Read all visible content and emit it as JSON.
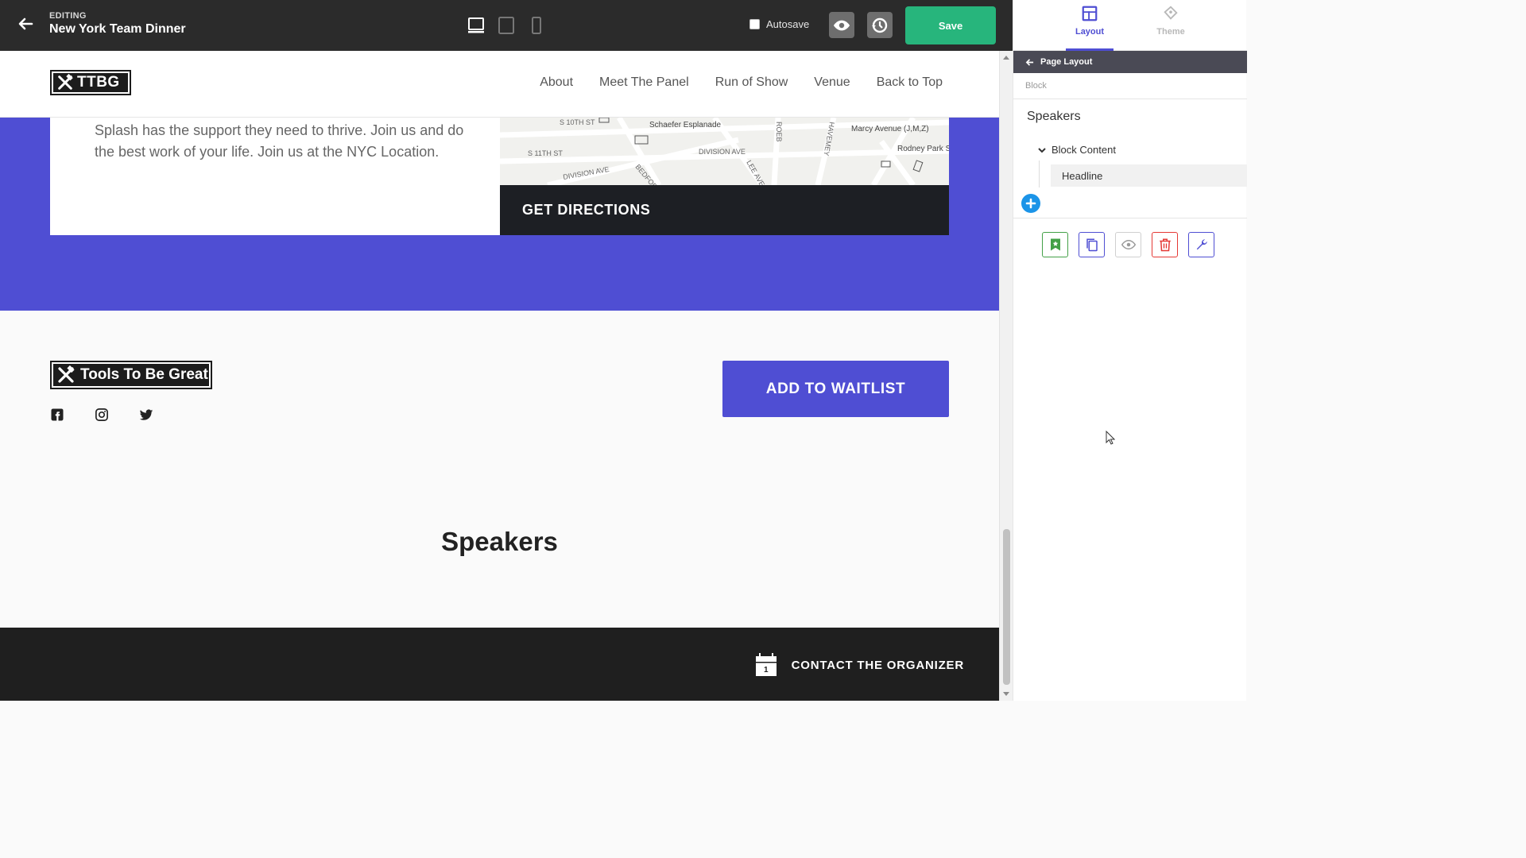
{
  "topbar": {
    "editing_label": "EDITING",
    "page_title": "New York Team Dinner",
    "autosave_label": "Autosave",
    "autosave_checked": false,
    "save_label": "Save",
    "active_device": "desktop"
  },
  "site_header": {
    "logo_text": "TTBG",
    "nav": [
      "About",
      "Meet The Panel",
      "Run of Show",
      "Venue",
      "Back to Top"
    ]
  },
  "venue": {
    "text": "Splash has the support they need to thrive. Join us and do the best work of your life. Join us at the NYC Location.",
    "map_labels": [
      "S 10TH ST",
      "Schaefer Esplanade",
      "Marcy Avenue (J,M,Z)",
      "S 11TH ST",
      "DIVISION AVE",
      "Rodney Park South",
      "DIVISION AVE",
      "BEDFORD",
      "LEE AVE",
      "ROEB",
      "HAVEMEY"
    ],
    "directions_label": "GET DIRECTIONS"
  },
  "footer": {
    "logo_text": "Tools To Be Great",
    "socials": [
      "facebook-icon",
      "instagram-icon",
      "twitter-icon"
    ],
    "waitlist_label": "ADD TO WAITLIST",
    "speakers_heading": "Speakers",
    "contact_label": "CONTACT THE ORGANIZER",
    "calendar_day": "1"
  },
  "panel": {
    "tabs": [
      {
        "label": "Layout",
        "active": true
      },
      {
        "label": "Theme",
        "active": false
      }
    ],
    "crumb": "Page Layout",
    "sub_label": "Block",
    "block_title": "Speakers",
    "tree_parent": "Block Content",
    "tree_child": "Headline",
    "colors": {
      "accent": "#4f4ed3",
      "save": "#27b57c",
      "add": "#1b94e8",
      "bookmark": "#43a047",
      "delete": "#e53935"
    }
  }
}
